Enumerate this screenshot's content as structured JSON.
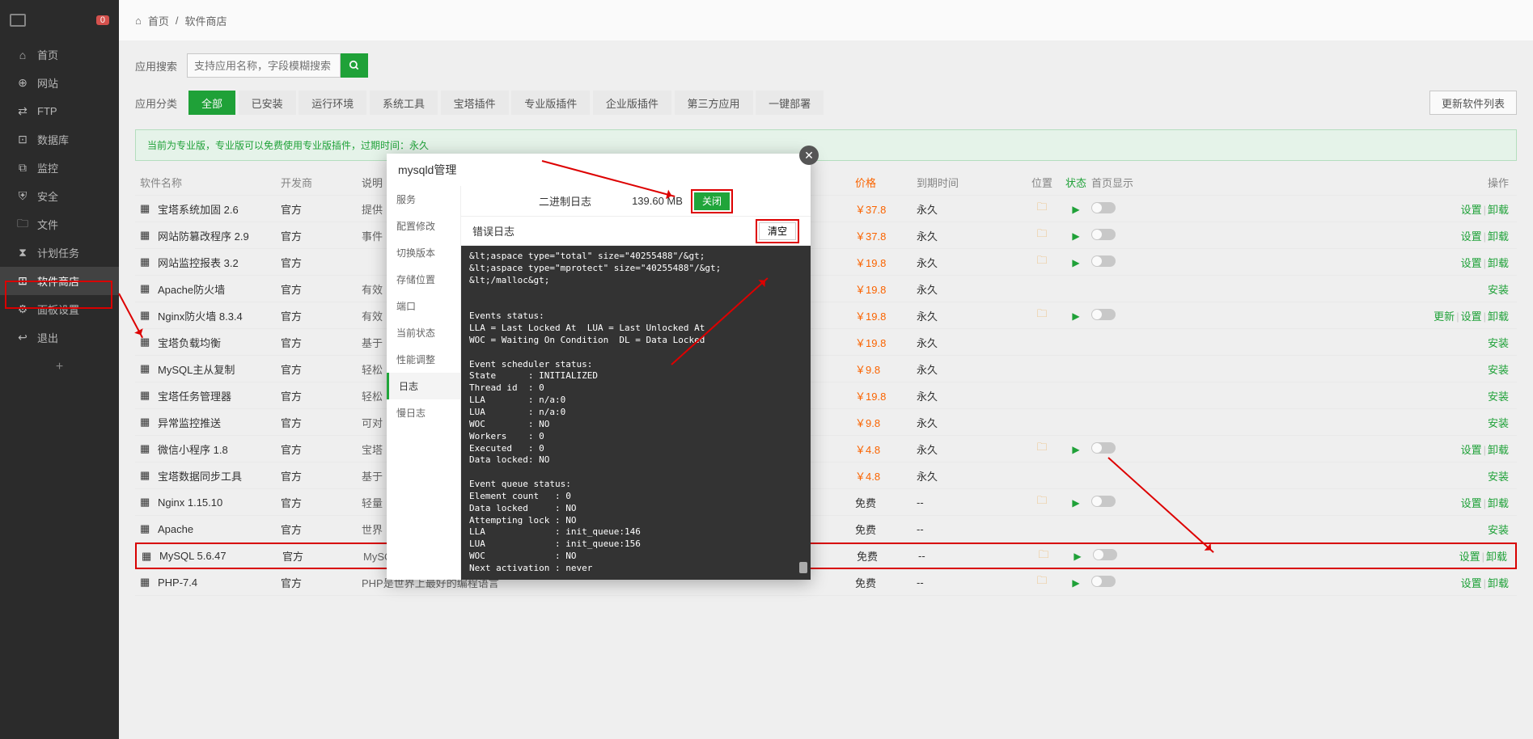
{
  "sidebar": {
    "badge": "0",
    "items": [
      {
        "icon": "⌂",
        "label": "首页"
      },
      {
        "icon": "⊕",
        "label": "网站"
      },
      {
        "icon": "⇄",
        "label": "FTP"
      },
      {
        "icon": "⊡",
        "label": "数据库"
      },
      {
        "icon": "⧉",
        "label": "监控"
      },
      {
        "icon": "⛨",
        "label": "安全"
      },
      {
        "icon": "🗀",
        "label": "文件"
      },
      {
        "icon": "⧗",
        "label": "计划任务"
      },
      {
        "icon": "⊞",
        "label": "软件商店"
      },
      {
        "icon": "⚙",
        "label": "面板设置"
      },
      {
        "icon": "↩",
        "label": "退出"
      }
    ]
  },
  "breadcrumb": {
    "home": "首页",
    "sep": "/",
    "current": "软件商店"
  },
  "search": {
    "label": "应用搜索",
    "placeholder": "支持应用名称，字段模糊搜索"
  },
  "cats": {
    "label": "应用分类",
    "items": [
      "全部",
      "已安装",
      "运行环境",
      "系统工具",
      "宝塔插件",
      "专业版插件",
      "企业版插件",
      "第三方应用",
      "一键部署"
    ],
    "update": "更新软件列表"
  },
  "notice": "当前为专业版，专业版可以免费使用专业版插件，过期时间：永久",
  "table": {
    "headers": {
      "name": "软件名称",
      "dev": "开发商",
      "desc": "说明",
      "price": "价格",
      "expire": "到期时间",
      "pos": "位置",
      "status": "状态",
      "home": "首页显示",
      "actions": "操作"
    },
    "folder_icon": "🗀",
    "play_icon": "▶",
    "rows": [
      {
        "name": "宝塔系统加固 2.6",
        "dev": "官方",
        "desc": "提供",
        "price": "￥37.8",
        "expire": "永久",
        "pos": true,
        "status": true,
        "home": true,
        "act": "设置 | 卸载"
      },
      {
        "name": "网站防篡改程序 2.9",
        "dev": "官方",
        "desc": "事件",
        "price": "￥37.8",
        "expire": "永久",
        "pos": true,
        "status": true,
        "home": true,
        "act": "设置 | 卸载"
      },
      {
        "name": "网站监控报表 3.2",
        "dev": "官方",
        "desc": "",
        "price": "￥19.8",
        "expire": "永久",
        "pos": true,
        "status": true,
        "home": true,
        "act": "设置 | 卸载"
      },
      {
        "name": "Apache防火墙",
        "dev": "官方",
        "desc": "有效",
        "price": "￥19.8",
        "expire": "永久",
        "pos": false,
        "status": false,
        "home": false,
        "act": "安装"
      },
      {
        "name": "Nginx防火墙 8.3.4",
        "dev": "官方",
        "desc": "有效",
        "price": "￥19.8",
        "expire": "永久",
        "pos": true,
        "status": true,
        "home": true,
        "act": "更新 | 设置 | 卸载"
      },
      {
        "name": "宝塔负载均衡",
        "dev": "官方",
        "desc": "基于",
        "price": "￥19.8",
        "expire": "永久",
        "pos": false,
        "status": false,
        "home": false,
        "act": "安装"
      },
      {
        "name": "MySQL主从复制",
        "dev": "官方",
        "desc": "轻松",
        "price": "￥9.8",
        "expire": "永久",
        "pos": false,
        "status": false,
        "home": false,
        "act": "安装"
      },
      {
        "name": "宝塔任务管理器",
        "dev": "官方",
        "desc": "轻松",
        "price": "￥19.8",
        "expire": "永久",
        "pos": false,
        "status": false,
        "home": false,
        "act": "安装"
      },
      {
        "name": "异常监控推送",
        "dev": "官方",
        "desc": "可对",
        "price": "￥9.8",
        "expire": "永久",
        "pos": false,
        "status": false,
        "home": false,
        "act": "安装"
      },
      {
        "name": "微信小程序 1.8",
        "dev": "官方",
        "desc": "宝塔",
        "price": "￥4.8",
        "expire": "永久",
        "pos": true,
        "status": true,
        "home": true,
        "act": "设置 | 卸载"
      },
      {
        "name": "宝塔数据同步工具",
        "dev": "官方",
        "desc": "基于",
        "price": "￥4.8",
        "expire": "永久",
        "pos": false,
        "status": false,
        "home": false,
        "act": "安装"
      },
      {
        "name": "Nginx 1.15.10",
        "dev": "官方",
        "desc": "轻量",
        "price": "免费",
        "expire": "--",
        "pos": true,
        "status": true,
        "home": true,
        "act": "设置 | 卸载"
      },
      {
        "name": "Apache",
        "dev": "官方",
        "desc": "世界",
        "price": "免费",
        "expire": "--",
        "pos": false,
        "status": false,
        "home": false,
        "act": "安装"
      },
      {
        "name": "MySQL 5.6.47",
        "dev": "官方",
        "desc": "MySQL是一种关系数据库管理系统!",
        "price": "免费",
        "expire": "--",
        "pos": true,
        "status": true,
        "home": true,
        "act": "设置 | 卸载",
        "hl": true
      },
      {
        "name": "PHP-7.4",
        "dev": "官方",
        "desc": "PHP是世界上最好的编程语言",
        "price": "免费",
        "expire": "--",
        "pos": true,
        "status": true,
        "home": true,
        "act": "设置 | 卸载"
      }
    ]
  },
  "modal": {
    "title": "mysqld管理",
    "close_icon": "✕",
    "side": [
      "服务",
      "配置修改",
      "切换版本",
      "存储位置",
      "端口",
      "当前状态",
      "性能调整",
      "日志",
      "慢日志"
    ],
    "active_side": 7,
    "binlog": {
      "label": "二进制日志",
      "size": "139.60 MB",
      "btn": "关闭"
    },
    "errlog": {
      "label": "错误日志",
      "clear": "清空"
    },
    "logtext": "&lt;aspace type=\"total\" size=\"40255488\"/&gt;\n&lt;aspace type=\"mprotect\" size=\"40255488\"/&gt;\n&lt;/malloc&gt;\n\n\nEvents status:\nLLA = Last Locked At  LUA = Last Unlocked At\nWOC = Waiting On Condition  DL = Data Locked\n\nEvent scheduler status:\nState      : INITIALIZED\nThread id  : 0\nLLA        : n/a:0\nLUA        : n/a:0\nWOC        : NO\nWorkers    : 0\nExecuted   : 0\nData locked: NO\n\nEvent queue status:\nElement count   : 0\nData locked     : NO\nAttempting lock : NO\nLLA             : init_queue:146\nLUA             : init_queue:156\nWOC             : NO\nNext activation : never"
  }
}
